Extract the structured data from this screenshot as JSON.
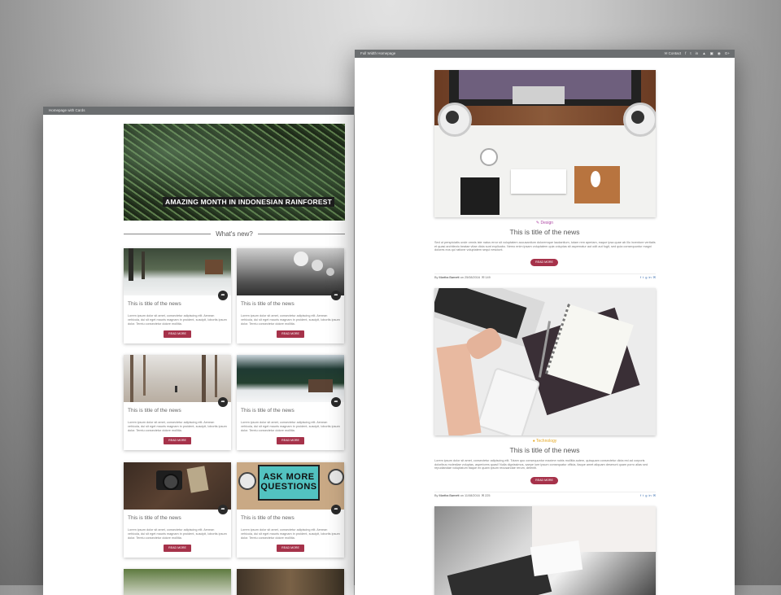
{
  "colors": {
    "accent": "#a6324a",
    "titlebar": "#6b6e70",
    "design": "#b04aa6",
    "technology": "#e5a823"
  },
  "left_window": {
    "title": "Homepage with Cards",
    "hero_caption": "AMAZING MONTH IN INDONESIAN RAINFOREST",
    "section_heading": "What's new?",
    "cards": [
      {
        "title": "This is title of the news",
        "text": "Lorem ipsum dolor sit amet, consectetur adipiscing elit. Aenean vehicula, dui sit eget mauris magnam in proident, suscipit, lobortis ipsum dolor. Tereiu consectetur dolore mollitia.",
        "button": "READ MORE",
        "icon": "share-icon"
      },
      {
        "title": "This is title of the news",
        "text": "Lorem ipsum dolor sit amet, consectetur adipiscing elit. Aenean vehicula, dui sit eget mauris magnam in proident, suscipit, lobortis ipsum dolor. Tereiu consectetur dolore mollitia.",
        "button": "READ MORE",
        "icon": "share-icon"
      },
      {
        "title": "This is title of the news",
        "text": "Lorem ipsum dolor sit amet, consectetur adipiscing elit. Aenean vehicula, dui sit eget mauris magnam in proident, suscipit, lobortis ipsum dolor. Tereiu consectetur dolore mollitia.",
        "button": "READ MORE",
        "icon": "share-icon"
      },
      {
        "title": "This is title of the news",
        "text": "Lorem ipsum dolor sit amet, consectetur adipiscing elit. Aenean vehicula, dui sit eget mauris magnam in proident, suscipit, lobortis ipsum dolor. Tereiu consectetur dolore mollitia.",
        "button": "READ MORE",
        "icon": "share-icon"
      },
      {
        "title": "This is title of the news",
        "text": "Lorem ipsum dolor sit amet, consectetur adipiscing elit. Aenean vehicula, dui sit eget mauris magnam in proident, suscipit, lobortis ipsum dolor. Tereiu consectetur dolore mollitia.",
        "button": "READ MORE",
        "icon": "share-icon"
      },
      {
        "title": "This is title of the news",
        "text": "Lorem ipsum dolor sit amet, consectetur adipiscing elit. Aenean vehicula, dui sit eget mauris magnam in proident, suscipit, lobortis ipsum dolor. Tereiu consectetur dolore mollitia.",
        "button": "READ MORE",
        "icon": "share-icon"
      }
    ],
    "card4_sign": "ASK MORE QUESTIONS"
  },
  "right_window": {
    "title": "Full Width Homepage",
    "contact": "Contact",
    "social_icons": [
      "facebook-icon",
      "twitter-icon",
      "linkedin-icon",
      "instagram-icon",
      "snapchat-icon",
      "dribbble-icon",
      "google-plus-icon"
    ],
    "posts": [
      {
        "category": "Design",
        "title": "This is title of the news",
        "text": "Sed ut perspiciatis unde omnis iste natus error sit voluptatem accusantium doloremque laudantium, totam rem aperiam, eaque ipsa quae ab illo inventore veritatis et quasi architecto beatae vitae dicta sunt explicabo. Nemo enim ipsam voluptatem quia voluptas sit aspernatur aut odit aut fugit, sed quia consequuntur magni dolores eos qui ratione voluptatem sequi nesciunt.",
        "button": "READ MORE",
        "by": "By",
        "author": "Martha Barnett",
        "date_prefix": "on",
        "date": "25/08/2016",
        "comments": "149"
      },
      {
        "category": "Technology",
        "title": "This is title of the news",
        "text": "Lorem ipsum dolor sit amet, consectetur adipiscing elit. Totam quo consequuntur maxime nobis mollitia autem, quisquam consectetur dicta est ad corporis doloribus molestiae voluptas, asperiores quasi! Nulla dignissimos, saepe iure ipsum consequatur officia, itaque amet aliquam deserunt quam porro alias sed repudiandae voluptatum itaque ex quam ipsum recusandae rerum, deleniti.",
        "button": "READ MORE",
        "by": "By",
        "author": "Martha Barnett",
        "date_prefix": "on",
        "date": "11/08/2016",
        "comments": "225"
      }
    ]
  }
}
